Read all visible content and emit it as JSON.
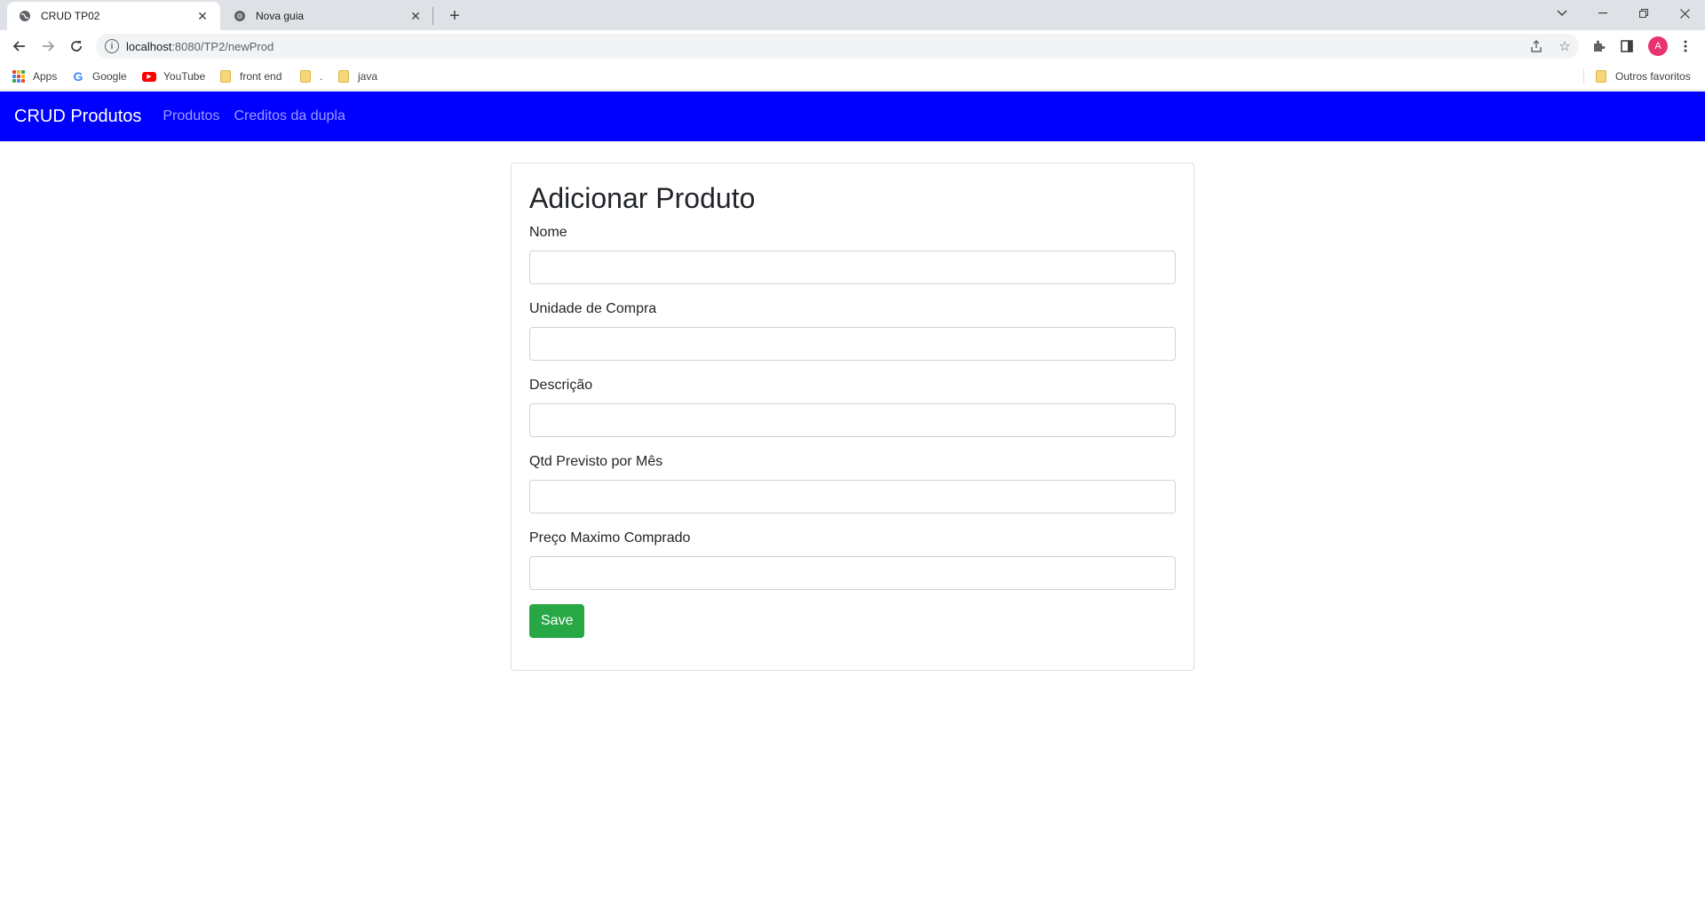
{
  "browser": {
    "tabs": [
      {
        "title": "CRUD TP02",
        "icon": "globe-icon"
      },
      {
        "title": "Nova guia",
        "icon": "chrome-icon"
      }
    ],
    "address": {
      "host": "localhost",
      "path": ":8080/TP2/newProd"
    },
    "bookmarks": [
      {
        "label": "Apps",
        "icon": "apps-grid-icon"
      },
      {
        "label": "Google",
        "icon": "google-icon"
      },
      {
        "label": "YouTube",
        "icon": "youtube-icon"
      },
      {
        "label": "front end",
        "icon": "folder-icon"
      },
      {
        "label": ".",
        "icon": "folder-icon"
      },
      {
        "label": "java",
        "icon": "folder-icon"
      }
    ],
    "other_bookmarks": "Outros favoritos",
    "profile_initial": "A"
  },
  "navbar": {
    "brand": "CRUD Produtos",
    "links": [
      "Produtos",
      "Creditos da dupla"
    ],
    "color": "#0000ff"
  },
  "form": {
    "title": "Adicionar Produto",
    "fields": [
      {
        "label": "Nome",
        "value": ""
      },
      {
        "label": "Unidade de Compra",
        "value": ""
      },
      {
        "label": "Descrição",
        "value": ""
      },
      {
        "label": "Qtd Previsto por Mês",
        "value": ""
      },
      {
        "label": "Preço Maximo Comprado",
        "value": ""
      }
    ],
    "save_label": "Save",
    "save_color": "#28a745"
  }
}
